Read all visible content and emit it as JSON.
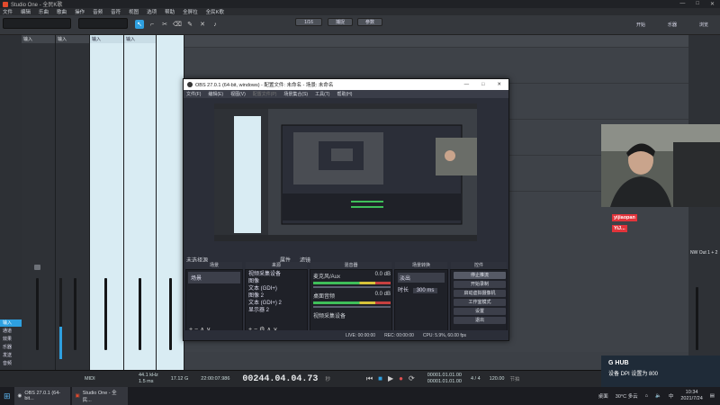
{
  "studio_one": {
    "title": "Studio One - 全民K歌",
    "menu": [
      "文件",
      "编辑",
      "乐曲",
      "歌曲",
      "操作",
      "音频",
      "音符",
      "视图",
      "选项",
      "帮助",
      "全屏拉",
      "全民K歌"
    ],
    "toolbar": {
      "btn_a": "1/16",
      "btn_b": "捕捉",
      "btn_c": "参数",
      "start": "开始",
      "mix": "乐器",
      "browse": "浏览"
    },
    "channels": [
      {
        "name": "输入",
        "foot": "音频"
      },
      {
        "name": "输入",
        "foot": "音频"
      },
      {
        "name": "输入",
        "foot": "音频"
      },
      {
        "name": "输入",
        "foot": "音频"
      }
    ],
    "inspector_items": [
      "输入",
      "通道",
      "效果",
      "乐器",
      "发送",
      "音频"
    ],
    "right_label": "NW Out 1 + 2"
  },
  "obs": {
    "title": "OBS 27.0.1 (64-bit, windows) - 配置文件: 未命名 - 场景: 未命名",
    "menu": [
      "文件(F)",
      "编辑(E)",
      "视图(V)",
      "配置文件(P)",
      "场景集合(S)",
      "工具(T)",
      "帮助(H)"
    ],
    "bar": [
      "未选择源",
      "属性",
      "滤镜"
    ],
    "docks": {
      "scenes": {
        "label": "场景",
        "items": [
          "场景"
        ]
      },
      "sources": {
        "label": "来源",
        "items": [
          "视频采集设备",
          "图像",
          "文本 (GDI+)",
          "图像 2",
          "文本 (GDI+) 2",
          "显示器 2"
        ]
      },
      "mixer": {
        "label": "混音器",
        "channels": [
          {
            "name": "麦克风/Aux",
            "db": "0.0 dB"
          },
          {
            "name": "桌面音频",
            "db": "0.0 dB"
          },
          {
            "name": "视频采集设备",
            "db": "0.0 dB"
          }
        ]
      },
      "transitions": {
        "label": "场景转换",
        "type": "淡出",
        "duration_label": "时长",
        "duration": "300 ms"
      },
      "controls": {
        "label": "控件",
        "buttons": [
          "停止推流",
          "开始录制",
          "启动虚拟摄像机",
          "工作室模式",
          "设置",
          "退出"
        ]
      }
    },
    "status": {
      "live": "LIVE: 00:00:00",
      "rec": "REC: 00:00:00",
      "cpu": "CPU: 5.9%, 60.00 fps"
    }
  },
  "webcam_chat": {
    "line1": "yijiaopan",
    "line2": "YiJ..."
  },
  "transport": {
    "midi": "MIDI",
    "sample_rate": "44.1 kHz",
    "latency": "1.5 ms",
    "mem": "17.12 G",
    "record_max": "22:00:07.986",
    "timecode": "00244.04.04.73",
    "seconds": "秒",
    "loop_start": "00001.01.01.00",
    "loop_end": "00001.01.01.00",
    "signature": "4 / 4",
    "tempo": "120.00",
    "tempo_label": "节拍",
    "metronome_label": "节拍器"
  },
  "notification": {
    "app": "G HUB",
    "text": "设备 DPI 设置为 800"
  },
  "taskbar": {
    "apps": [
      "OBS 27.0.1 (64-bit...",
      "Studio One - 全民..."
    ],
    "desktop": "桌面",
    "temp": "30°C 多云",
    "lang": "中",
    "time": "10:34",
    "date": "2021/7/24"
  },
  "colors": {
    "accent": "#2ea0e0",
    "obs_bg": "#2b2e38",
    "s1_bg": "#3e4248",
    "chat_badge": "#e2343b"
  }
}
